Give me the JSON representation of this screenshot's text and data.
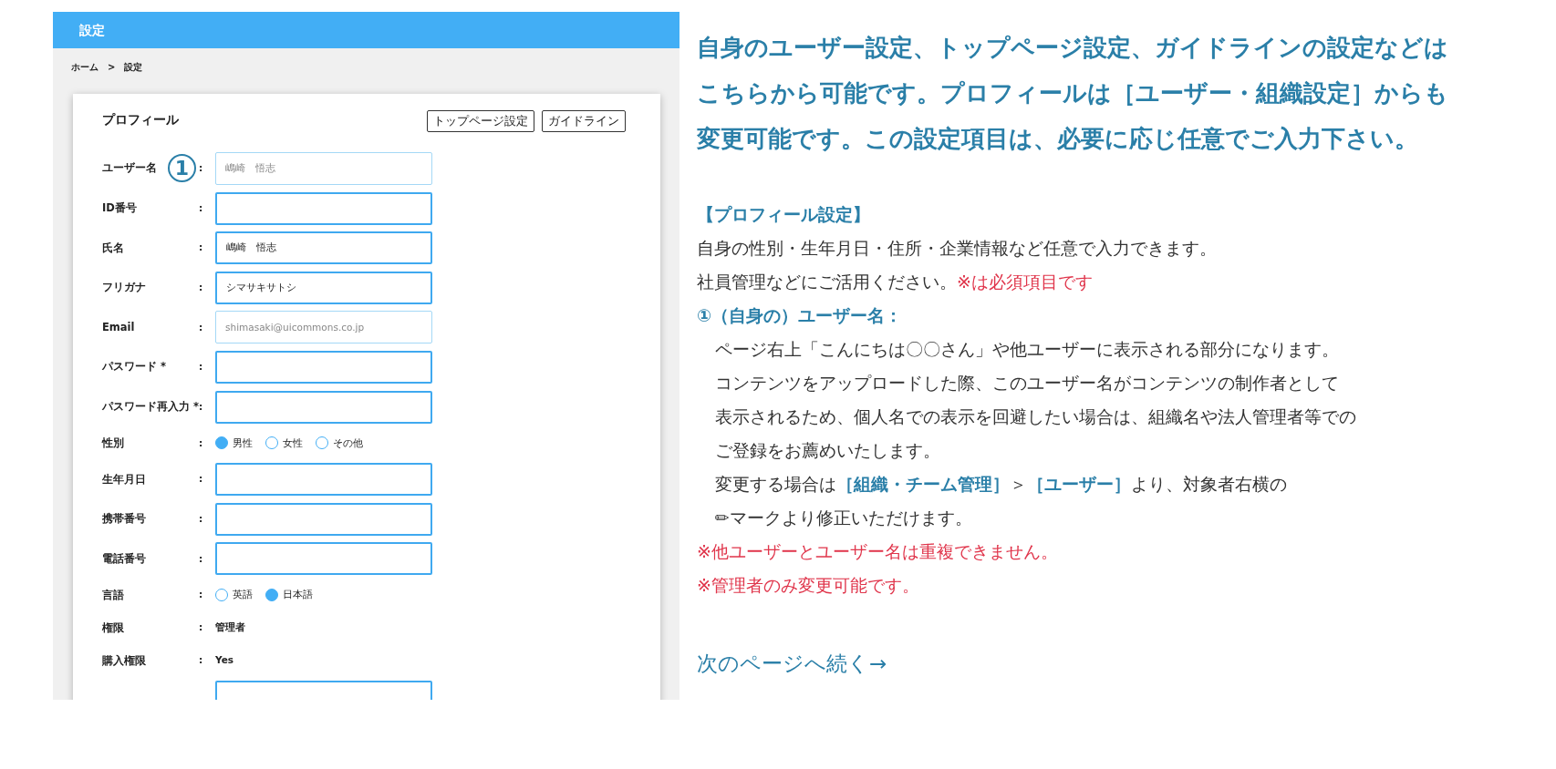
{
  "app": {
    "header_title": "設定",
    "breadcrumb": [
      "ホーム",
      "設定"
    ],
    "breadcrumb_separator": ">",
    "card": {
      "title": "プロフィール",
      "buttons": [
        "トップページ設定",
        "ガイドライン"
      ],
      "rows": [
        {
          "kind": "input",
          "label": "ユーザー名",
          "colon": ":",
          "value": "嶋崎　悟志",
          "disabled": true,
          "callout": "1"
        },
        {
          "kind": "input",
          "label": "ID番号",
          "colon": ":",
          "disabled": false
        },
        {
          "kind": "input",
          "label": "氏名",
          "colon": ":",
          "value": "嶋崎　悟志",
          "disabled": false
        },
        {
          "kind": "input",
          "label": "フリガナ",
          "colon": ":",
          "value": "シマサキサトシ",
          "disabled": false
        },
        {
          "kind": "input",
          "label": "Email",
          "colon": ":",
          "value": "shimasaki@uicommons.co.jp",
          "disabled": true
        },
        {
          "kind": "input",
          "label": "パスワード *",
          "colon": ":",
          "disabled": false
        },
        {
          "kind": "input",
          "label": "パスワード再入力 *",
          "colon": ":",
          "disabled": false
        },
        {
          "kind": "radio",
          "label": "性別",
          "colon": ":",
          "options": [
            {
              "label": "男性",
              "selected": true
            },
            {
              "label": "女性",
              "selected": false
            },
            {
              "label": "その他",
              "selected": false
            }
          ]
        },
        {
          "kind": "input",
          "label": "生年月日",
          "colon": ":",
          "disabled": false
        },
        {
          "kind": "input",
          "label": "携帯番号",
          "colon": ":",
          "disabled": false
        },
        {
          "kind": "input",
          "label": "電話番号",
          "colon": ":",
          "disabled": false
        },
        {
          "kind": "radio",
          "label": "言語",
          "colon": ":",
          "options": [
            {
              "label": "英語",
              "selected": false
            },
            {
              "label": "日本語",
              "selected": true
            }
          ]
        },
        {
          "kind": "text",
          "label": "権限",
          "colon": ":",
          "value": "管理者"
        },
        {
          "kind": "text",
          "label": "購入権限",
          "colon": ":",
          "value": "Yes"
        },
        {
          "kind": "input",
          "disabled": false
        }
      ]
    }
  },
  "explanation": {
    "heading_lines": [
      "自身のユーザー設定、トップページ設定、ガイドラインの設定などは",
      "こちらから可能です。プロフィールは［ユーザー・組織設定］からも",
      "変更可能です。この設定項目は、必要に応じ任意でご入力下さい。"
    ],
    "lines": [
      {
        "indent": false,
        "segments": [
          {
            "emphasis": true,
            "warning": false,
            "text": "【プロフィール設定】"
          }
        ]
      },
      {
        "indent": false,
        "segments": [
          {
            "emphasis": false,
            "warning": false,
            "text": "自身の性別・生年月日・住所・企業情報など任意で入力できます。"
          }
        ]
      },
      {
        "indent": false,
        "segments": [
          {
            "emphasis": false,
            "warning": false,
            "text": "社員管理などにご活用ください。"
          },
          {
            "emphasis": false,
            "warning": true,
            "text": "※は必須項目です"
          }
        ]
      },
      {
        "indent": false,
        "segments": [
          {
            "emphasis": true,
            "warning": false,
            "text": "①（自身の）ユーザー名："
          }
        ]
      },
      {
        "indent": true,
        "segments": [
          {
            "emphasis": false,
            "warning": false,
            "text": "ページ右上「こんにちは〇〇さん」や他ユーザーに表示される部分になります。"
          }
        ]
      },
      {
        "indent": true,
        "segments": [
          {
            "emphasis": false,
            "warning": false,
            "text": "コンテンツをアップロードした際、このユーザー名がコンテンツの制作者として"
          }
        ]
      },
      {
        "indent": true,
        "segments": [
          {
            "emphasis": false,
            "warning": false,
            "text": "表示されるため、個人名での表示を回避したい場合は、組織名や法人管理者等での"
          }
        ]
      },
      {
        "indent": true,
        "segments": [
          {
            "emphasis": false,
            "warning": false,
            "text": "ご登録をお薦めいたします。"
          }
        ]
      },
      {
        "indent": true,
        "segments": [
          {
            "emphasis": false,
            "warning": false,
            "text": "変更する場合は"
          },
          {
            "emphasis": true,
            "warning": false,
            "text": "［組織・チーム管理］"
          },
          {
            "emphasis": false,
            "warning": false,
            "text": "＞"
          },
          {
            "emphasis": true,
            "warning": false,
            "text": "［ユーザー］"
          },
          {
            "emphasis": false,
            "warning": false,
            "text": "より、対象者右横の"
          }
        ]
      },
      {
        "indent": true,
        "segments": [
          {
            "emphasis": false,
            "warning": false,
            "text": "✏マークより修正いただけます。"
          }
        ]
      },
      {
        "indent": false,
        "segments": [
          {
            "emphasis": false,
            "warning": true,
            "text": "※他ユーザーとユーザー名は重複できません。"
          }
        ]
      },
      {
        "indent": false,
        "segments": [
          {
            "emphasis": false,
            "warning": true,
            "text": "※管理者のみ変更可能です。"
          }
        ]
      }
    ],
    "next_link": "次のページへ続く→"
  }
}
